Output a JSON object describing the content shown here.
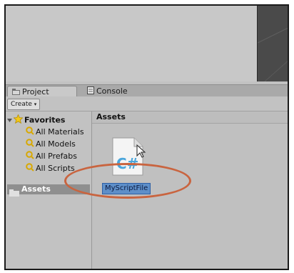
{
  "tabs": {
    "project_label": "Project",
    "console_label": "Console"
  },
  "toolbar": {
    "create_label": "Create",
    "create_arrow": "▾"
  },
  "sidebar": {
    "favorites_label": "Favorites",
    "items": [
      {
        "label": "All Materials",
        "icon": "search-icon"
      },
      {
        "label": "All Models",
        "icon": "search-icon"
      },
      {
        "label": "All Prefabs",
        "icon": "search-icon"
      },
      {
        "label": "All Scripts",
        "icon": "search-icon"
      }
    ],
    "assets_label": "Assets"
  },
  "main": {
    "breadcrumb": "Assets",
    "file": {
      "name": "MyScriptFile",
      "icon": "csharp-script-icon",
      "icon_text": "C#"
    }
  },
  "colors": {
    "selection": "#5e8fc9",
    "annotation": "#c9643f",
    "favorites_star": "#f2c81a"
  }
}
